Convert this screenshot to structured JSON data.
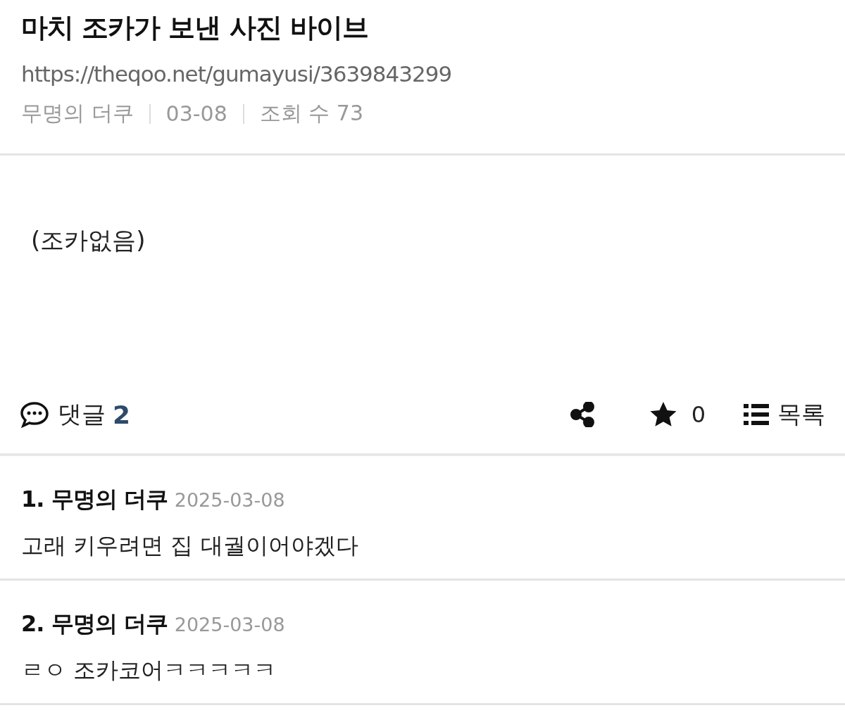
{
  "post": {
    "title": "마치 조카가 보낸 사진 바이브",
    "url": "https://theqoo.net/gumayusi/3639843299",
    "author": "무명의 더쿠",
    "date": "03-08",
    "views": "조회 수 73",
    "body": "(조카없음)"
  },
  "actions": {
    "comments_label": "댓글",
    "comments_count": "2",
    "star_count": "0",
    "list_label": "목록"
  },
  "comments": [
    {
      "number": "1.",
      "author": "무명의 더쿠",
      "date": "2025-03-08",
      "text": "고래 키우려면 집 대궐이어야겠다"
    },
    {
      "number": "2.",
      "author": "무명의 더쿠",
      "date": "2025-03-08",
      "text": "ㄹㅇ 조카코어ㅋㅋㅋㅋㅋ"
    }
  ]
}
